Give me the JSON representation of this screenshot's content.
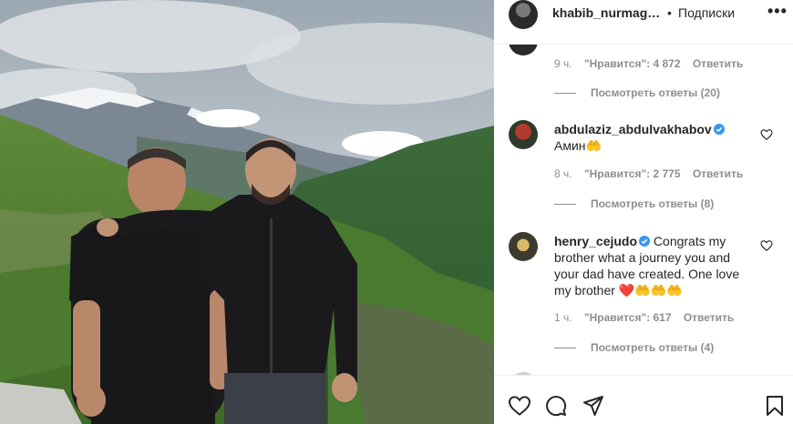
{
  "post": {
    "username": "khabib_nurmagomedov",
    "separator": "•",
    "follow_label": "Подписки",
    "more_label": "•••"
  },
  "comments": [
    {
      "username": "",
      "text": "",
      "time": "9 ч.",
      "likes": "\"Нравится\": 4 872",
      "reply_label": "Ответить",
      "view_replies": "Посмотреть ответы (20)"
    },
    {
      "username": "abdulaziz_abdulvakhabov",
      "verified": true,
      "text": "Амин🤲",
      "time": "8 ч.",
      "likes": "\"Нравится\": 2 775",
      "reply_label": "Ответить",
      "view_replies": "Посмотреть ответы (8)"
    },
    {
      "username": "henry_cejudo",
      "verified": true,
      "text": "Congrats my brother what a journey you and your dad have created. One love my brother ❤️🤲🤲🤲",
      "time": "1 ч.",
      "likes": "\"Нравится\": 617",
      "reply_label": "Ответить",
      "view_replies": "Посмотреть ответы (4)"
    }
  ],
  "colors": {
    "text": "#262626",
    "muted": "#8e8e8e",
    "verified": "#3897f0",
    "border": "#efefef"
  },
  "icons": [
    "more-options-icon",
    "heart-icon",
    "comment-icon",
    "share-icon",
    "bookmark-icon",
    "verified-badge-icon"
  ]
}
